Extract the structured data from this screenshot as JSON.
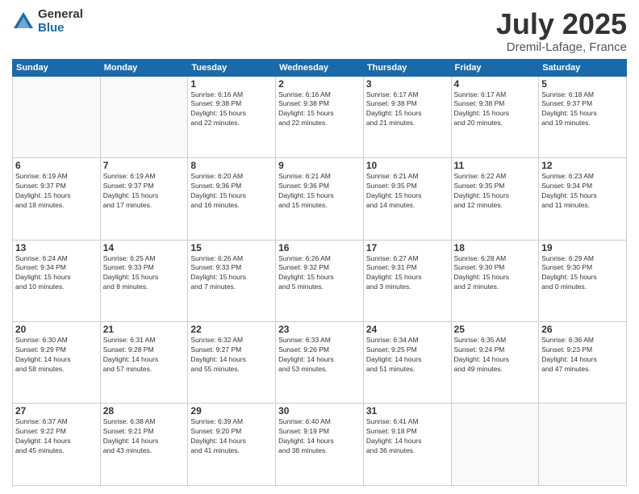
{
  "header": {
    "logo_general": "General",
    "logo_blue": "Blue",
    "month": "July 2025",
    "location": "Dremil-Lafage, France"
  },
  "weekdays": [
    "Sunday",
    "Monday",
    "Tuesday",
    "Wednesday",
    "Thursday",
    "Friday",
    "Saturday"
  ],
  "weeks": [
    [
      {
        "day": "",
        "info": ""
      },
      {
        "day": "",
        "info": ""
      },
      {
        "day": "1",
        "info": "Sunrise: 6:16 AM\nSunset: 9:38 PM\nDaylight: 15 hours\nand 22 minutes."
      },
      {
        "day": "2",
        "info": "Sunrise: 6:16 AM\nSunset: 9:38 PM\nDaylight: 15 hours\nand 22 minutes."
      },
      {
        "day": "3",
        "info": "Sunrise: 6:17 AM\nSunset: 9:38 PM\nDaylight: 15 hours\nand 21 minutes."
      },
      {
        "day": "4",
        "info": "Sunrise: 6:17 AM\nSunset: 9:38 PM\nDaylight: 15 hours\nand 20 minutes."
      },
      {
        "day": "5",
        "info": "Sunrise: 6:18 AM\nSunset: 9:37 PM\nDaylight: 15 hours\nand 19 minutes."
      }
    ],
    [
      {
        "day": "6",
        "info": "Sunrise: 6:19 AM\nSunset: 9:37 PM\nDaylight: 15 hours\nand 18 minutes."
      },
      {
        "day": "7",
        "info": "Sunrise: 6:19 AM\nSunset: 9:37 PM\nDaylight: 15 hours\nand 17 minutes."
      },
      {
        "day": "8",
        "info": "Sunrise: 6:20 AM\nSunset: 9:36 PM\nDaylight: 15 hours\nand 16 minutes."
      },
      {
        "day": "9",
        "info": "Sunrise: 6:21 AM\nSunset: 9:36 PM\nDaylight: 15 hours\nand 15 minutes."
      },
      {
        "day": "10",
        "info": "Sunrise: 6:21 AM\nSunset: 9:35 PM\nDaylight: 15 hours\nand 14 minutes."
      },
      {
        "day": "11",
        "info": "Sunrise: 6:22 AM\nSunset: 9:35 PM\nDaylight: 15 hours\nand 12 minutes."
      },
      {
        "day": "12",
        "info": "Sunrise: 6:23 AM\nSunset: 9:34 PM\nDaylight: 15 hours\nand 11 minutes."
      }
    ],
    [
      {
        "day": "13",
        "info": "Sunrise: 6:24 AM\nSunset: 9:34 PM\nDaylight: 15 hours\nand 10 minutes."
      },
      {
        "day": "14",
        "info": "Sunrise: 6:25 AM\nSunset: 9:33 PM\nDaylight: 15 hours\nand 8 minutes."
      },
      {
        "day": "15",
        "info": "Sunrise: 6:26 AM\nSunset: 9:33 PM\nDaylight: 15 hours\nand 7 minutes."
      },
      {
        "day": "16",
        "info": "Sunrise: 6:26 AM\nSunset: 9:32 PM\nDaylight: 15 hours\nand 5 minutes."
      },
      {
        "day": "17",
        "info": "Sunrise: 6:27 AM\nSunset: 9:31 PM\nDaylight: 15 hours\nand 3 minutes."
      },
      {
        "day": "18",
        "info": "Sunrise: 6:28 AM\nSunset: 9:30 PM\nDaylight: 15 hours\nand 2 minutes."
      },
      {
        "day": "19",
        "info": "Sunrise: 6:29 AM\nSunset: 9:30 PM\nDaylight: 15 hours\nand 0 minutes."
      }
    ],
    [
      {
        "day": "20",
        "info": "Sunrise: 6:30 AM\nSunset: 9:29 PM\nDaylight: 14 hours\nand 58 minutes."
      },
      {
        "day": "21",
        "info": "Sunrise: 6:31 AM\nSunset: 9:28 PM\nDaylight: 14 hours\nand 57 minutes."
      },
      {
        "day": "22",
        "info": "Sunrise: 6:32 AM\nSunset: 9:27 PM\nDaylight: 14 hours\nand 55 minutes."
      },
      {
        "day": "23",
        "info": "Sunrise: 6:33 AM\nSunset: 9:26 PM\nDaylight: 14 hours\nand 53 minutes."
      },
      {
        "day": "24",
        "info": "Sunrise: 6:34 AM\nSunset: 9:25 PM\nDaylight: 14 hours\nand 51 minutes."
      },
      {
        "day": "25",
        "info": "Sunrise: 6:35 AM\nSunset: 9:24 PM\nDaylight: 14 hours\nand 49 minutes."
      },
      {
        "day": "26",
        "info": "Sunrise: 6:36 AM\nSunset: 9:23 PM\nDaylight: 14 hours\nand 47 minutes."
      }
    ],
    [
      {
        "day": "27",
        "info": "Sunrise: 6:37 AM\nSunset: 9:22 PM\nDaylight: 14 hours\nand 45 minutes."
      },
      {
        "day": "28",
        "info": "Sunrise: 6:38 AM\nSunset: 9:21 PM\nDaylight: 14 hours\nand 43 minutes."
      },
      {
        "day": "29",
        "info": "Sunrise: 6:39 AM\nSunset: 9:20 PM\nDaylight: 14 hours\nand 41 minutes."
      },
      {
        "day": "30",
        "info": "Sunrise: 6:40 AM\nSunset: 9:19 PM\nDaylight: 14 hours\nand 38 minutes."
      },
      {
        "day": "31",
        "info": "Sunrise: 6:41 AM\nSunset: 9:18 PM\nDaylight: 14 hours\nand 36 minutes."
      },
      {
        "day": "",
        "info": ""
      },
      {
        "day": "",
        "info": ""
      }
    ]
  ]
}
